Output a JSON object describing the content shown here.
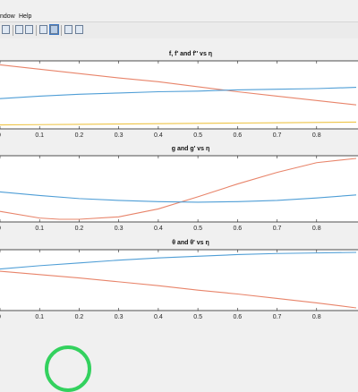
{
  "menubar": {
    "window_partial": "ndow",
    "help": "Help"
  },
  "toolbar": {
    "icons": [
      "print-icon",
      "zoom-in-icon",
      "zoom-out-icon",
      "pan-icon",
      "rotate-icon",
      "datacursor-icon",
      "brush-icon",
      "link-icon",
      "colorbar-icon",
      "legend-icon",
      "hide-tools-icon",
      "dock-icon"
    ]
  },
  "colors": {
    "blue": "#4f9ed6",
    "orange": "#e8846a",
    "yellow": "#eec447",
    "axis": "#262626"
  },
  "chart_data": [
    {
      "type": "line",
      "title": "f, f' and f'' vs η",
      "xticks": [
        "0.1",
        "0.2",
        "0.3",
        "0.4",
        "0.5",
        "0.6",
        "0.7",
        "0.8"
      ],
      "xlim": [
        0,
        0.9
      ],
      "ylim": [
        0,
        1
      ],
      "series": [
        {
          "color": "#e8846a",
          "x": [
            0,
            0.1,
            0.2,
            0.3,
            0.4,
            0.5,
            0.6,
            0.7,
            0.8,
            0.9
          ],
          "y": [
            0.98,
            0.91,
            0.84,
            0.77,
            0.71,
            0.63,
            0.55,
            0.48,
            0.41,
            0.34
          ]
        },
        {
          "color": "#4f9ed6",
          "x": [
            0,
            0.1,
            0.2,
            0.3,
            0.4,
            0.5,
            0.6,
            0.7,
            0.8,
            0.9
          ],
          "y": [
            0.44,
            0.48,
            0.51,
            0.53,
            0.55,
            0.56,
            0.58,
            0.59,
            0.6,
            0.62
          ]
        },
        {
          "color": "#eec447",
          "x": [
            0,
            0.1,
            0.2,
            0.3,
            0.4,
            0.5,
            0.6,
            0.7,
            0.8,
            0.9
          ],
          "y": [
            0.02,
            0.025,
            0.03,
            0.035,
            0.04,
            0.045,
            0.05,
            0.055,
            0.06,
            0.065
          ]
        }
      ]
    },
    {
      "type": "line",
      "title": "g and g' vs η",
      "xticks": [
        "0.1",
        "0.2",
        "0.3",
        "0.4",
        "0.5",
        "0.6",
        "0.7",
        "0.8"
      ],
      "xlim": [
        0,
        0.9
      ],
      "ylim": [
        0,
        1
      ],
      "series": [
        {
          "color": "#e8846a",
          "x": [
            0,
            0.1,
            0.15,
            0.2,
            0.3,
            0.4,
            0.5,
            0.6,
            0.7,
            0.8,
            0.9
          ],
          "y": [
            0.13,
            0.02,
            0.0,
            0.0,
            0.04,
            0.17,
            0.37,
            0.58,
            0.77,
            0.93,
            1.0
          ]
        },
        {
          "color": "#4f9ed6",
          "x": [
            0,
            0.1,
            0.2,
            0.3,
            0.4,
            0.5,
            0.6,
            0.7,
            0.8,
            0.9
          ],
          "y": [
            0.45,
            0.39,
            0.34,
            0.31,
            0.29,
            0.28,
            0.29,
            0.31,
            0.35,
            0.4
          ]
        }
      ]
    },
    {
      "type": "line",
      "title": "θ and θ' vs η",
      "xticks": [
        "0.1",
        "0.2",
        "0.3",
        "0.4",
        "0.5",
        "0.6",
        "0.7",
        "0.8"
      ],
      "xlim": [
        0,
        0.9
      ],
      "ylim": [
        0,
        1
      ],
      "series": [
        {
          "color": "#4f9ed6",
          "x": [
            0,
            0.1,
            0.2,
            0.3,
            0.4,
            0.5,
            0.6,
            0.7,
            0.8,
            0.9
          ],
          "y": [
            0.7,
            0.76,
            0.81,
            0.86,
            0.9,
            0.93,
            0.96,
            0.98,
            0.99,
            1.0
          ]
        },
        {
          "color": "#e8846a",
          "x": [
            0,
            0.1,
            0.2,
            0.3,
            0.4,
            0.5,
            0.6,
            0.7,
            0.8,
            0.9
          ],
          "y": [
            0.66,
            0.6,
            0.54,
            0.47,
            0.4,
            0.32,
            0.25,
            0.17,
            0.09,
            0.0
          ]
        }
      ]
    }
  ]
}
